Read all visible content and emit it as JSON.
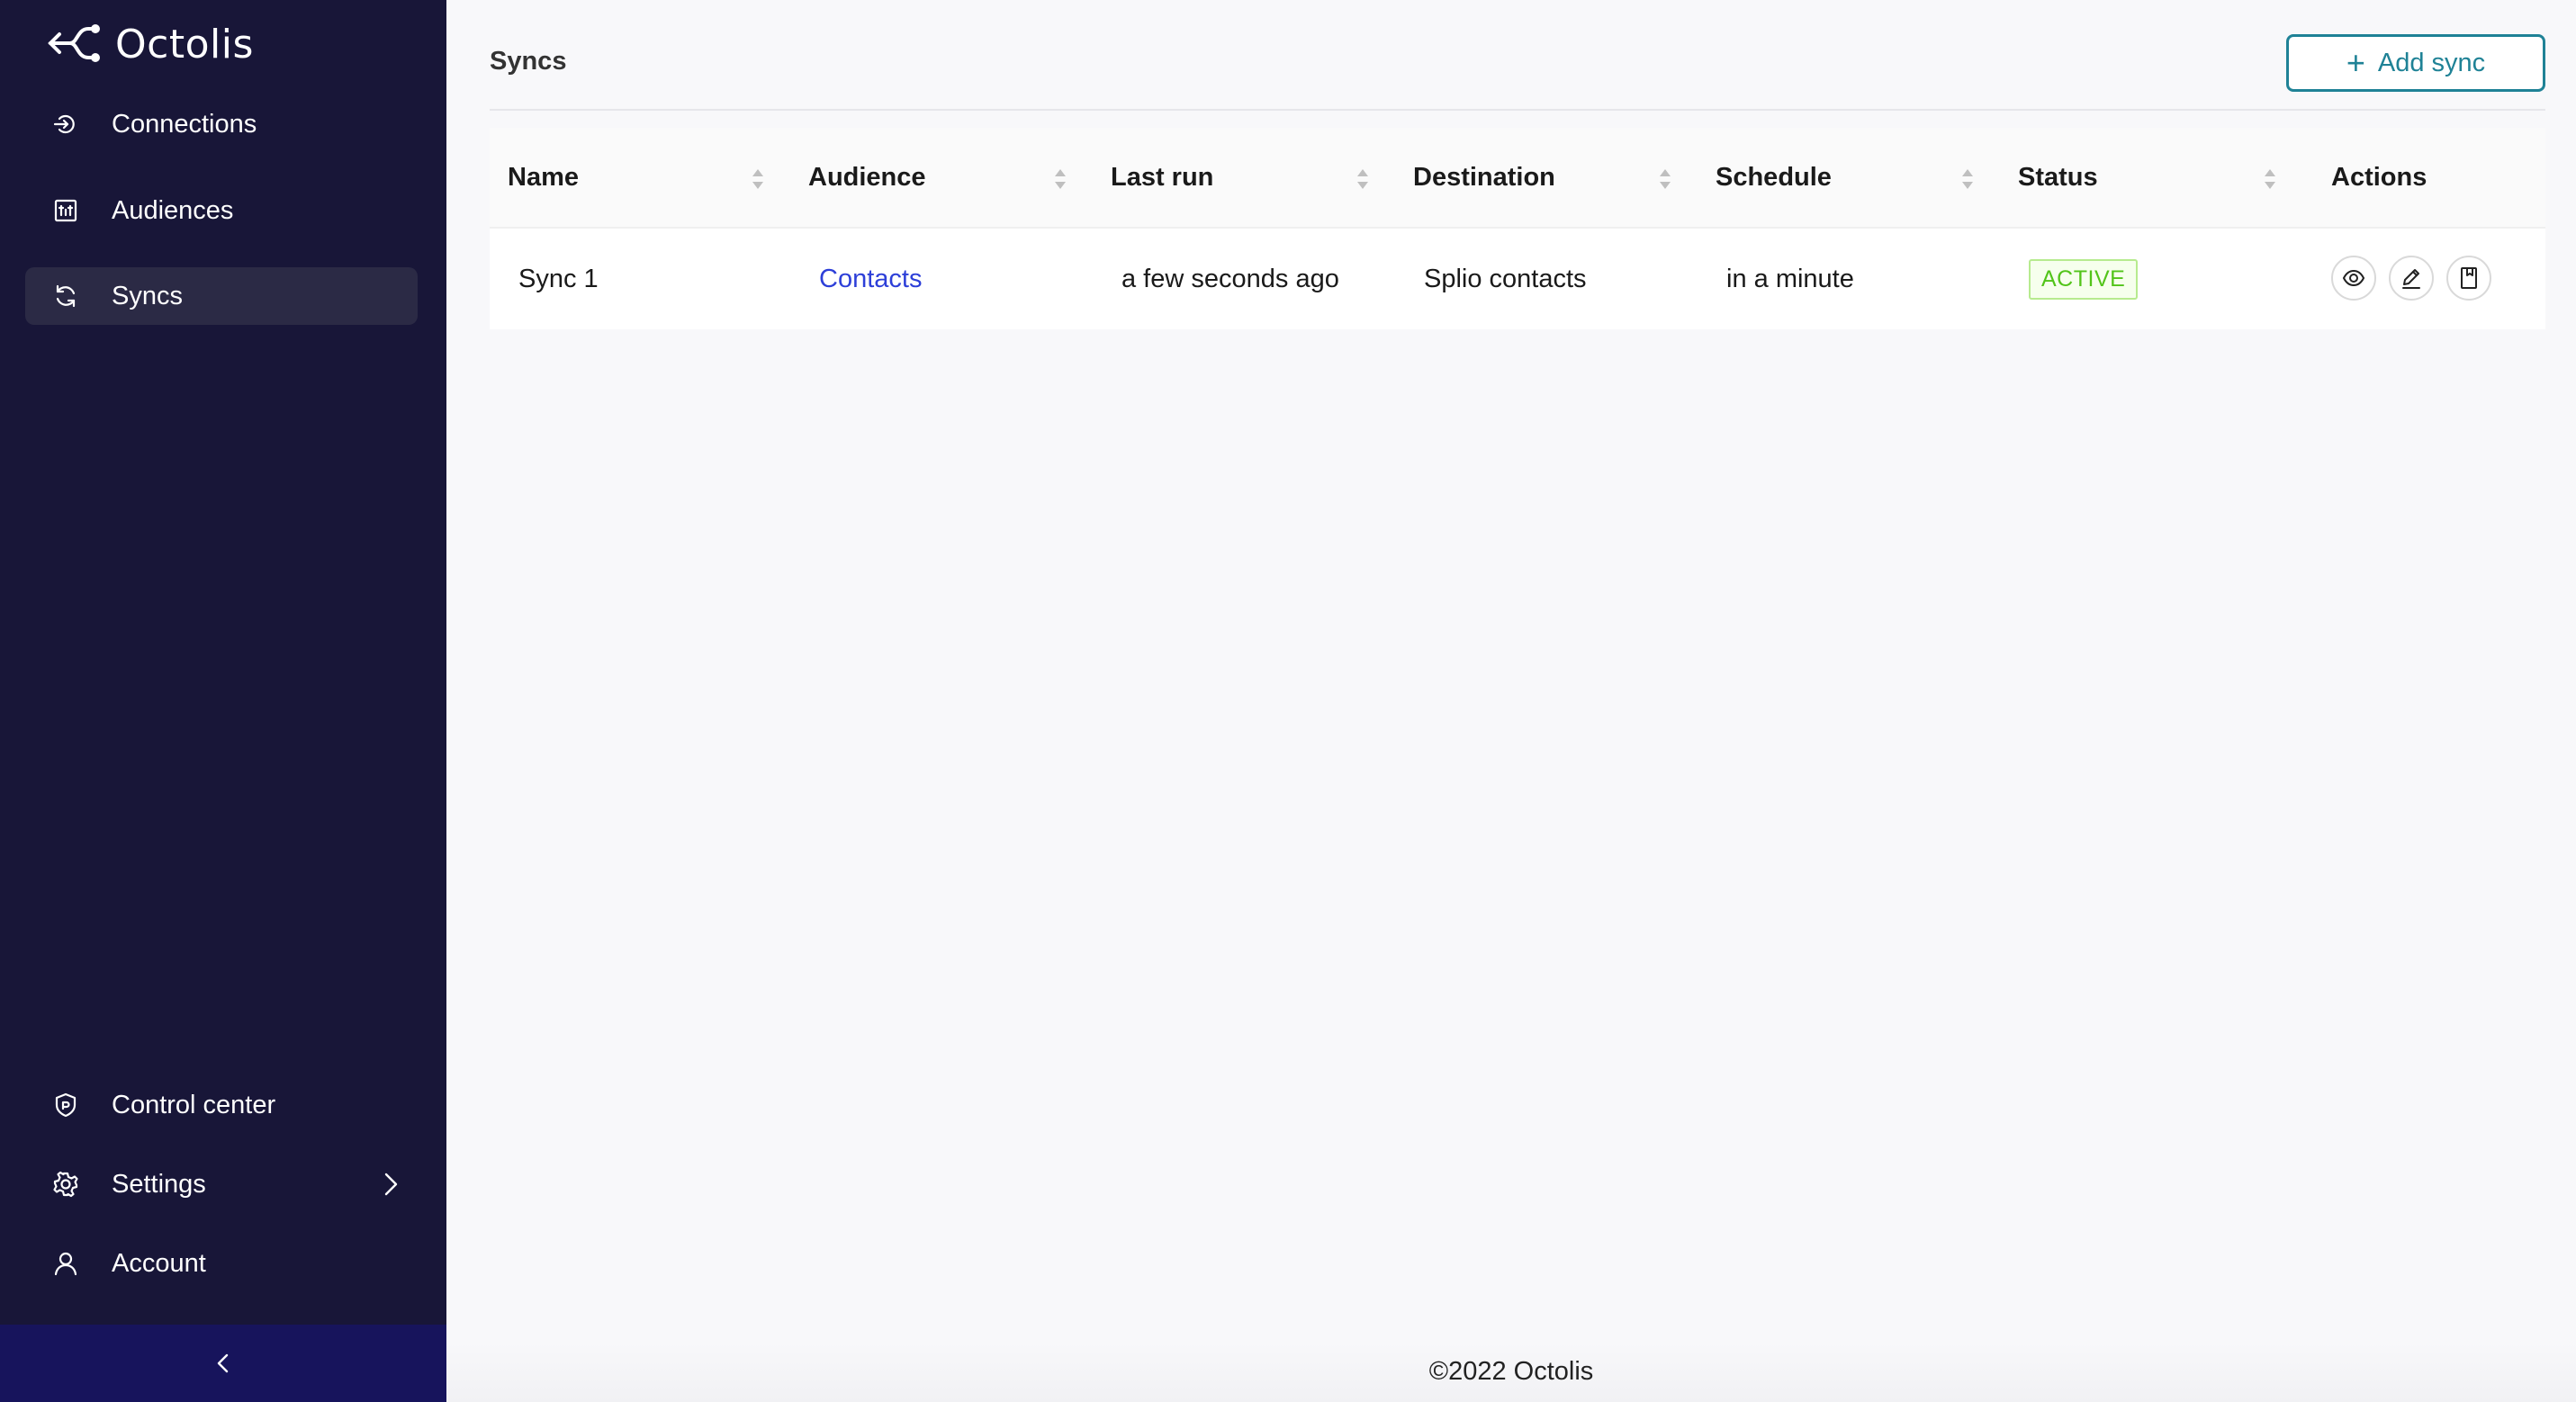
{
  "app": {
    "name": "Octolis"
  },
  "sidebar": {
    "top_items": [
      {
        "label": "Connections",
        "icon": "login-icon"
      },
      {
        "label": "Audiences",
        "icon": "audience-icon"
      },
      {
        "label": "Syncs",
        "icon": "sync-icon",
        "active": true
      }
    ],
    "bottom_items": [
      {
        "label": "Control center",
        "icon": "shield-icon"
      },
      {
        "label": "Settings",
        "icon": "gear-icon",
        "has_submenu": true
      },
      {
        "label": "Account",
        "icon": "user-icon"
      }
    ]
  },
  "page": {
    "title": "Syncs",
    "add_button_label": "Add sync"
  },
  "table": {
    "columns": [
      "Name",
      "Audience",
      "Last run",
      "Destination",
      "Schedule",
      "Status",
      "Actions"
    ],
    "rows": [
      {
        "name": "Sync 1",
        "audience": "Contacts",
        "last_run": "a few seconds ago",
        "destination": "Splio contacts",
        "schedule": "in a minute",
        "status": "ACTIVE",
        "actions": [
          "eye-icon",
          "edit-icon",
          "document-icon"
        ]
      }
    ]
  },
  "footer": {
    "text": "©2022 Octolis"
  },
  "colors": {
    "sidebar_bg": "#181638",
    "accent": "#1f8296",
    "link": "#2d3fd8",
    "status_active": "#52c41a"
  }
}
